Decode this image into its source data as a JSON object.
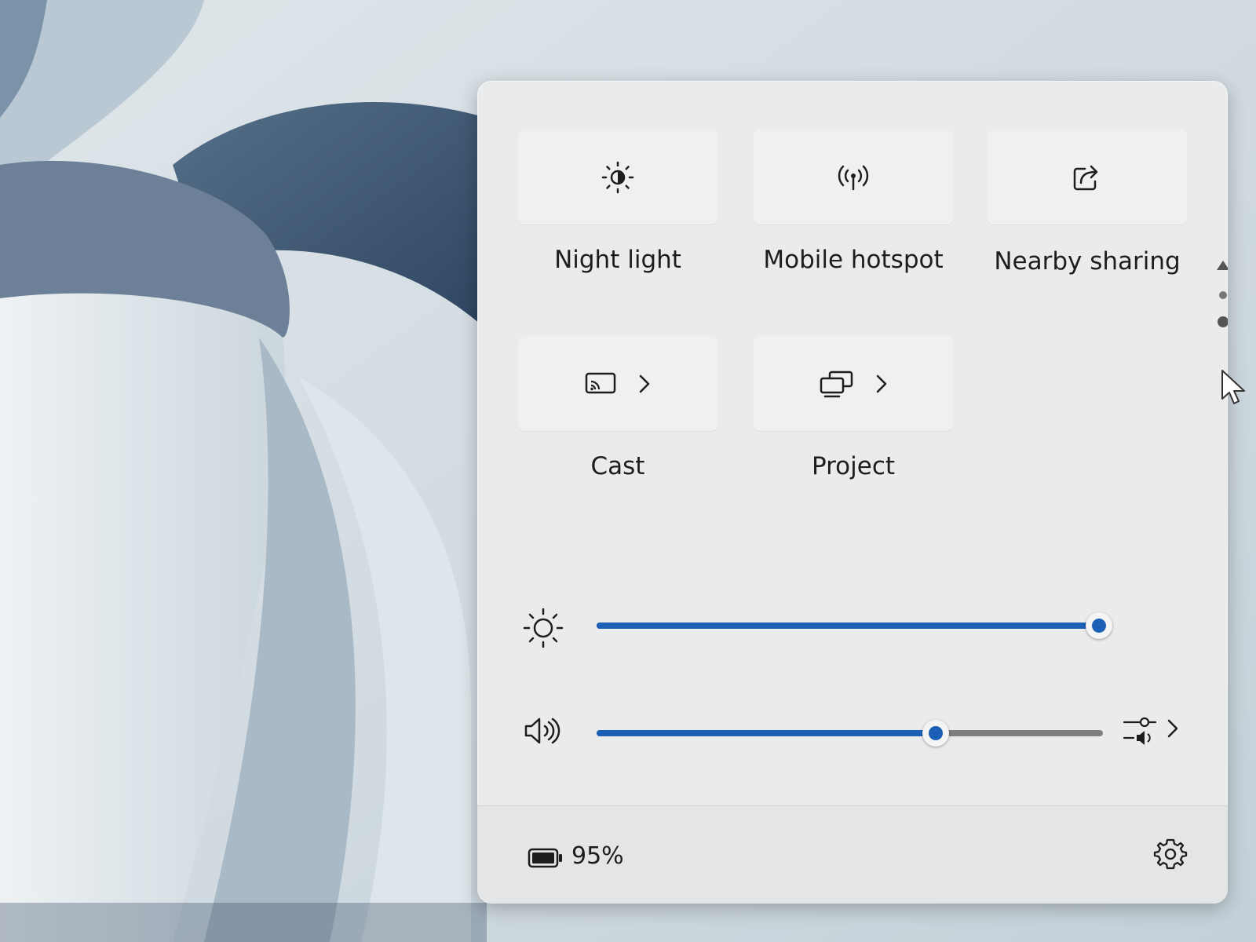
{
  "tiles": [
    {
      "label": "Night light",
      "icon": "night-light-icon"
    },
    {
      "label": "Mobile hotspot",
      "icon": "hotspot-icon"
    },
    {
      "label": "Nearby sharing",
      "icon": "share-icon"
    },
    {
      "label": "Cast",
      "icon": "cast-icon",
      "has_chevron": true
    },
    {
      "label": "Project",
      "icon": "project-icon",
      "has_chevron": true
    }
  ],
  "brightness": {
    "icon": "brightness-icon",
    "level_percent": 100
  },
  "volume": {
    "icon": "speaker-icon",
    "level_percent": 67,
    "mixer_icon": "volume-mixer-icon"
  },
  "battery": {
    "icon": "battery-icon",
    "percent": "95%"
  },
  "settings": {
    "icon": "gear-icon"
  },
  "colors": {
    "accent": "#1b5fb6",
    "panel": "#e9ebec"
  }
}
